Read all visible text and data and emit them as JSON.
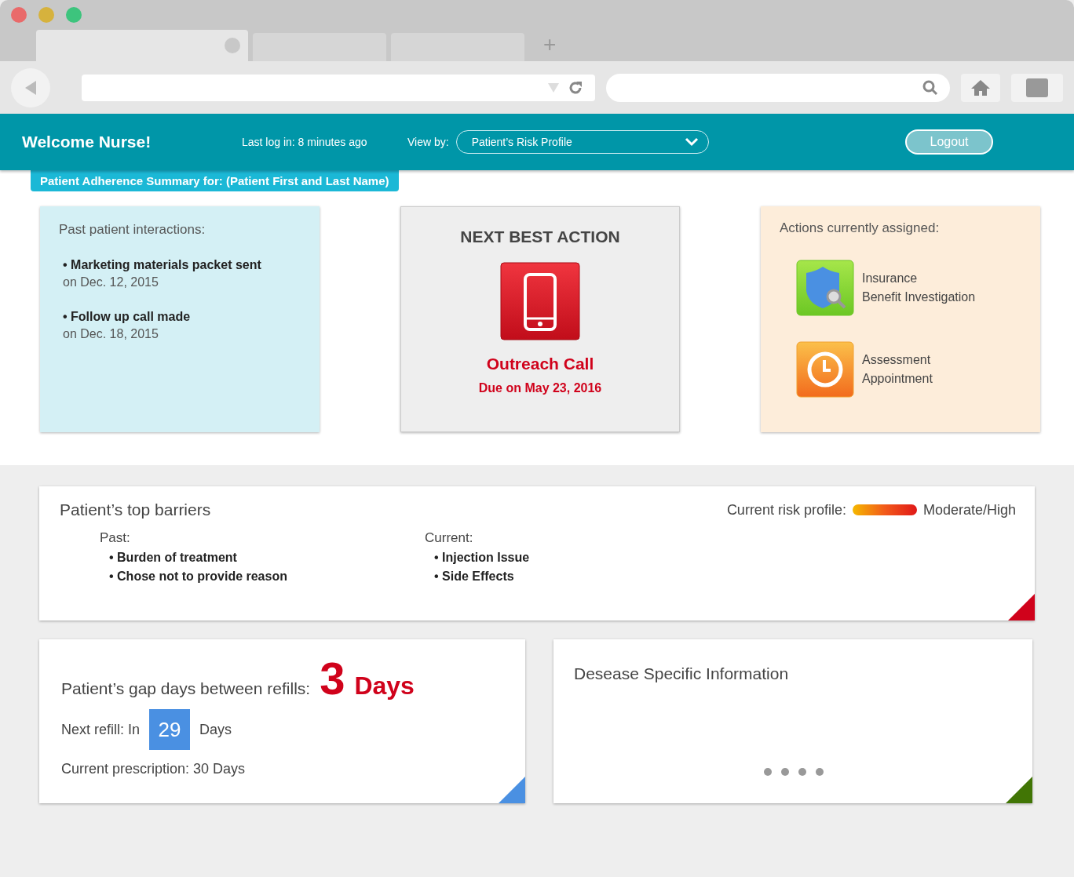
{
  "browser": {
    "tabs": [
      {
        "selected": true
      },
      {
        "selected": false
      },
      {
        "selected": false
      }
    ],
    "new_tab": "+"
  },
  "header": {
    "greeting": "Welcome Nurse!",
    "last_login": "Last log in: 8 minutes ago",
    "view_by_label": "View by:",
    "view_by_value": "Patient’s Risk Profile",
    "logout": "Logout"
  },
  "summary_tab": "Patient Adherence Summary for: (Patient First and Last Name)",
  "past_interactions": {
    "title": "Past patient interactions:",
    "items": [
      {
        "text": "• Marketing materials packet sent",
        "date": "on Dec. 12, 2015"
      },
      {
        "text": "• Follow up call made",
        "date": "on Dec. 18, 2015"
      }
    ]
  },
  "next_best_action": {
    "title": "NEXT BEST ACTION",
    "action": "Outreach Call",
    "due": "Due on May 23, 2016"
  },
  "assigned_actions": {
    "title": "Actions currently assigned:",
    "items": [
      {
        "kind": "insurance",
        "lines": [
          "Insurance",
          "Benefit Investigation"
        ]
      },
      {
        "kind": "appointment",
        "lines": [
          "Assessment",
          "Appointment"
        ]
      }
    ]
  },
  "barriers": {
    "title": "Patient’s top barriers",
    "risk_label": "Current risk profile:",
    "risk_value": "Moderate/High",
    "groups": [
      {
        "label": "Past:",
        "items": [
          "• Burden of treatment",
          "• Chose not to provide reason"
        ]
      },
      {
        "label": "Current:",
        "items": [
          "• Injection Issue",
          "• Side Effects"
        ]
      }
    ]
  },
  "refills": {
    "title": "Patient’s gap days between refills:",
    "gap_number": "3",
    "gap_unit": "Days",
    "next_label": "Next refill: In",
    "next_days": "29",
    "next_unit": "Days",
    "prescription": "Current prescription: 30 Days"
  },
  "disease_info": {
    "title": "Desease Specific Information"
  }
}
